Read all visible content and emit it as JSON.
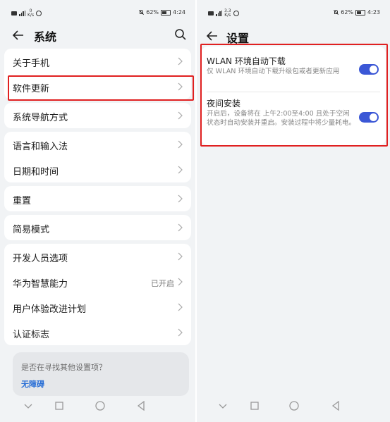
{
  "left_screen": {
    "status_bar": {
      "left_speed": "0\nK/s",
      "battery": "62%",
      "time": "4:24"
    },
    "header": {
      "title": "系统"
    },
    "groups": [
      {
        "items": [
          {
            "label": "关于手机"
          },
          {
            "label": "软件更新"
          }
        ]
      },
      {
        "items": [
          {
            "label": "系统导航方式"
          }
        ]
      },
      {
        "items": [
          {
            "label": "语言和输入法"
          },
          {
            "label": "日期和时间"
          }
        ]
      },
      {
        "items": [
          {
            "label": "重置"
          }
        ]
      },
      {
        "items": [
          {
            "label": "简易模式"
          }
        ]
      },
      {
        "items": [
          {
            "label": "开发人员选项"
          },
          {
            "label": "华为智慧能力",
            "value": "已开启"
          },
          {
            "label": "用户体验改进计划"
          },
          {
            "label": "认证标志"
          }
        ]
      }
    ],
    "help_card": {
      "question": "是否在寻找其他设置项？",
      "link": "无障碍"
    }
  },
  "right_screen": {
    "status_bar": {
      "left_speed": "3.3\nK/s",
      "battery": "62%",
      "time": "4:23"
    },
    "header": {
      "title": "设置"
    },
    "settings": [
      {
        "title": "WLAN 环境自动下载",
        "description": "仅 WLAN 环境自动下载升级包或者更新应用",
        "enabled": true
      },
      {
        "title": "夜间安装",
        "description": "开启后，设备将在 上午2:00至4:00 且处于空闲状态时自动安装并重启。安装过程中将少量耗电。",
        "enabled": true
      }
    ]
  },
  "colors": {
    "accent": "#3b57d6",
    "highlight": "#e02020",
    "link": "#2a6fd6"
  }
}
